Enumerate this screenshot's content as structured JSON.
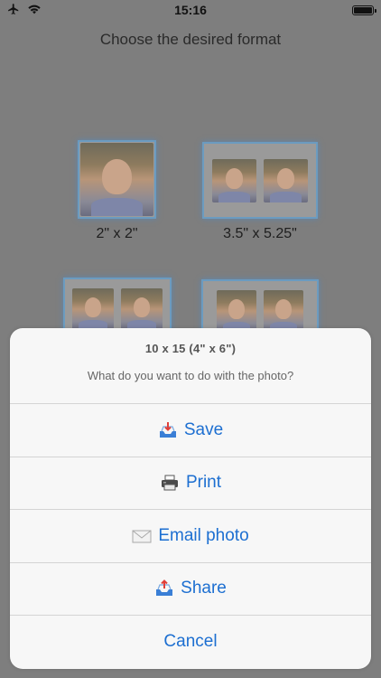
{
  "status_bar": {
    "time": "15:16",
    "airplane_icon": "airplane-icon",
    "wifi_icon": "wifi-icon",
    "battery_icon": "battery-icon"
  },
  "page": {
    "heading": "Choose the desired format"
  },
  "formats": [
    {
      "label": "2\" x 2\""
    },
    {
      "label": "3.5\" x 5.25\""
    },
    {
      "label": ""
    },
    {
      "label": ""
    }
  ],
  "action_sheet": {
    "title": "10 x 15 (4\" x 6\")",
    "message": "What do you want to do with the photo?",
    "actions": [
      {
        "label": "Save",
        "icon": "inbox-tray-icon"
      },
      {
        "label": "Print",
        "icon": "printer-icon"
      },
      {
        "label": "Email photo",
        "icon": "envelope-icon"
      },
      {
        "label": "Share",
        "icon": "share-tray-icon"
      },
      {
        "label": "Cancel"
      }
    ]
  },
  "colors": {
    "accent": "#1d6fd1",
    "dim_overlay": "#7e7e7e",
    "sheet_bg": "#f7f7f7"
  }
}
